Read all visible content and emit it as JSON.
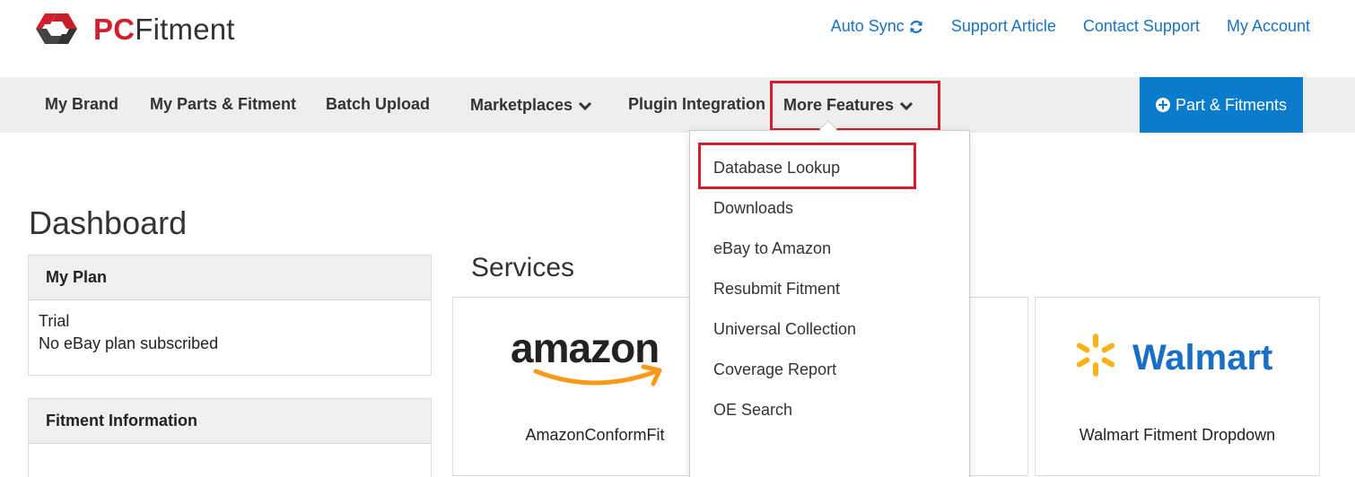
{
  "brand": {
    "name_part1": "PC",
    "name_part2": "Fitment",
    "colors": {
      "red": "#d0202e",
      "dark": "#333333"
    }
  },
  "top_links": {
    "auto_sync": "Auto Sync",
    "support_article": "Support Article",
    "contact_support": "Contact Support",
    "my_account": "My Account",
    "color": "#1a73c0"
  },
  "nav": {
    "my_brand": "My Brand",
    "my_parts": "My Parts & Fitment",
    "batch_upload": "Batch Upload",
    "marketplaces": "Marketplaces",
    "plugin_integration": "Plugin Integration",
    "more_features": "More Features",
    "add_button": "Part & Fitments",
    "add_button_color": "#0b7bcb"
  },
  "dropdown": {
    "items": [
      "Database Lookup",
      "Downloads",
      "eBay to Amazon",
      "Resubmit Fitment",
      "Universal Collection",
      "Coverage Report",
      "OE Search"
    ]
  },
  "dashboard": {
    "title": "Dashboard",
    "my_plan": {
      "heading": "My Plan",
      "line1": "Trial",
      "line2": "No eBay plan subscribed"
    },
    "fitment_info": {
      "heading": "Fitment Information"
    }
  },
  "services": {
    "title": "Services",
    "cards": [
      {
        "logo_text": "amazon",
        "label": "AmazonConformFit"
      },
      {
        "logo_text": "Walmart",
        "label": "Walmart Fitment Dropdown"
      }
    ]
  },
  "highlight_color": "#d0202e"
}
